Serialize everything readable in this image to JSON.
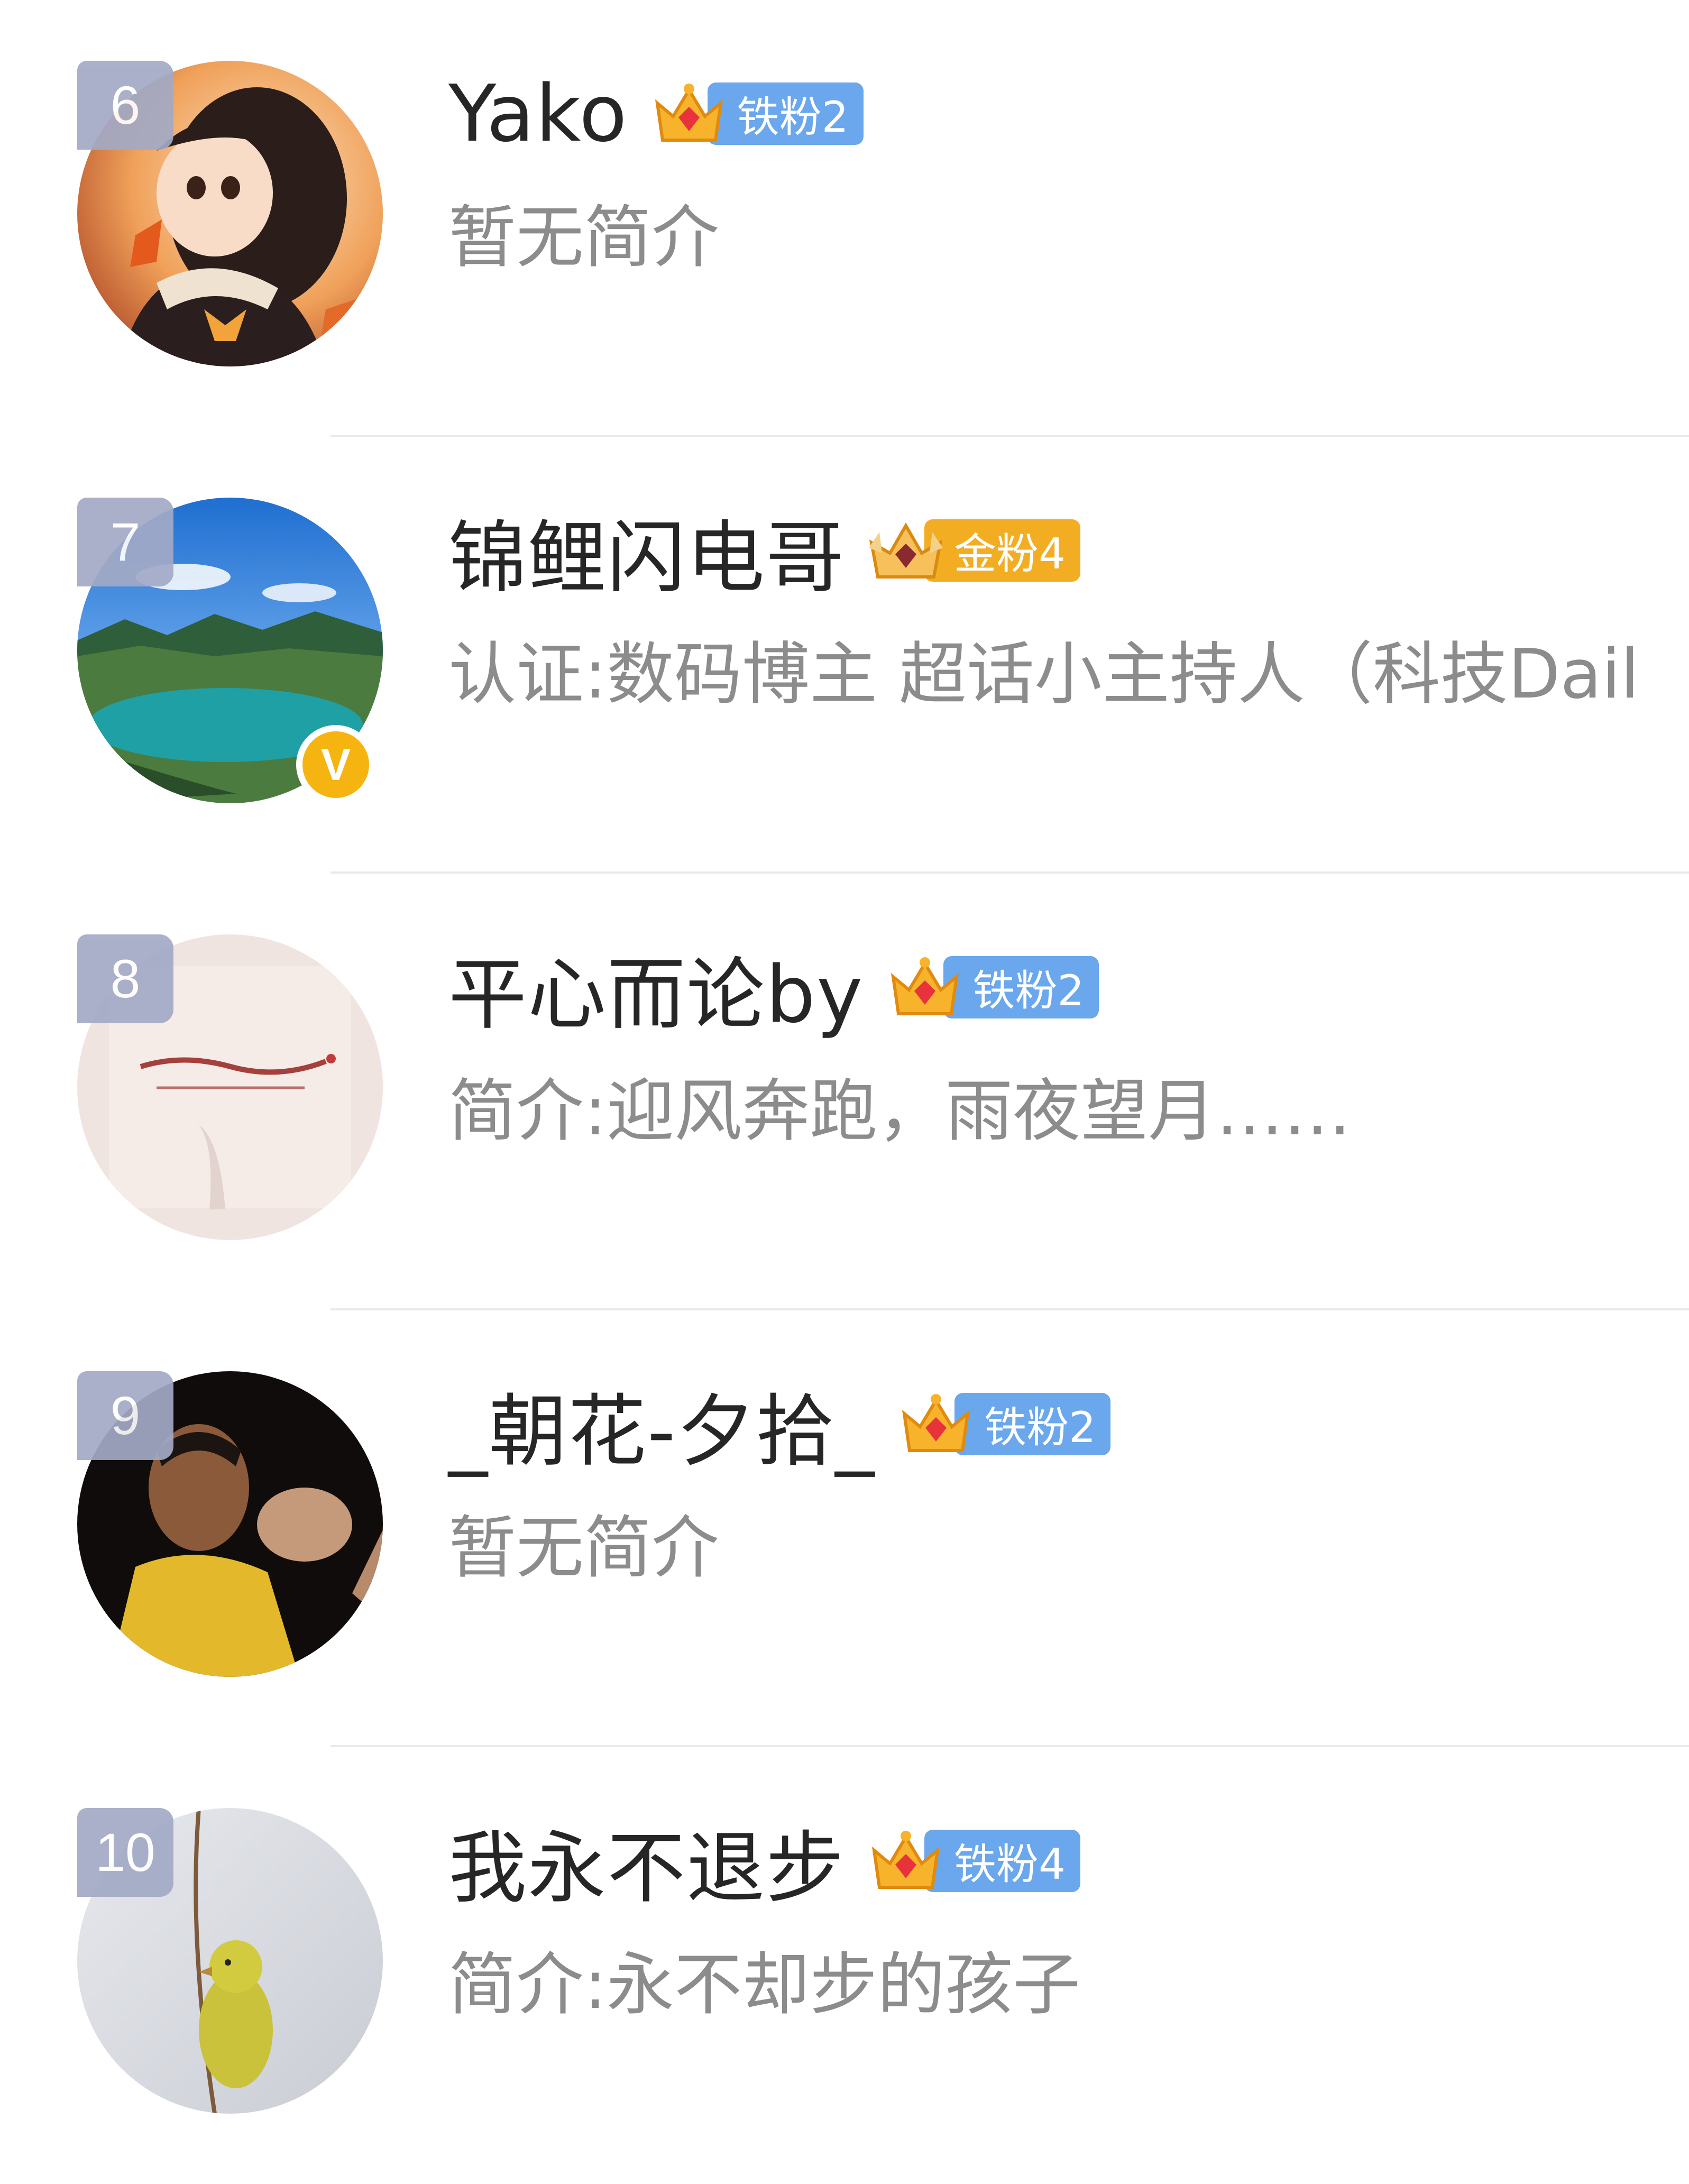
{
  "list": {
    "items": [
      {
        "rank": "6",
        "name": "Yako",
        "badge": {
          "label": "铁粉2",
          "crown_level": "2",
          "type": "iron"
        },
        "description": "暂无简介",
        "verified": false,
        "avatar_icon": "anime-girl-autumn-leaves-avatar"
      },
      {
        "rank": "7",
        "name": "锦鲤闪电哥",
        "badge": {
          "label": "金粉4",
          "crown_level": "5",
          "type": "gold"
        },
        "description": "认证:数码博主 超话小主持人（科技Dail…",
        "verified": true,
        "verified_label": "V",
        "avatar_icon": "mountain-lake-avatar"
      },
      {
        "rank": "8",
        "name": "平心而论by",
        "badge": {
          "label": "铁粉2",
          "crown_level": "6",
          "type": "iron"
        },
        "description": "简介:迎风奔跑，雨夜望月……",
        "verified": false,
        "avatar_icon": "calligraphy-card-avatar"
      },
      {
        "rank": "9",
        "name": "_朝花-夕拾_",
        "badge": {
          "label": "铁粉2",
          "crown_level": "2",
          "type": "iron"
        },
        "description": "暂无简介",
        "verified": false,
        "avatar_icon": "martial-artist-avatar"
      },
      {
        "rank": "10",
        "name": "我永不退步",
        "badge": {
          "label": "铁粉4",
          "crown_level": "3",
          "type": "iron"
        },
        "description": "简介:永不却步的孩子",
        "verified": false,
        "avatar_icon": "yellow-bird-avatar"
      }
    ]
  },
  "colors": {
    "iron_badge": "#6aa7ec",
    "gold_badge": "#f3ad23",
    "rank_badge": "#a3aac6",
    "verified": "#f6b411",
    "name_text": "#262626",
    "desc_text": "#8c8c8c"
  }
}
